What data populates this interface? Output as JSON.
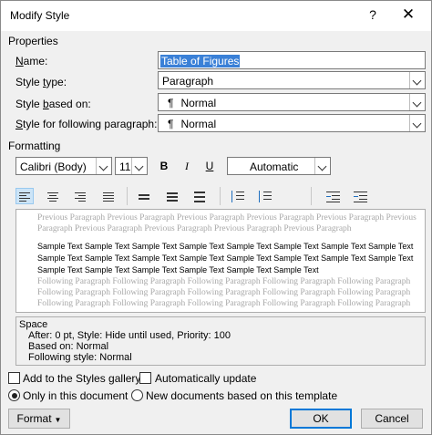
{
  "window": {
    "title": "Modify Style",
    "help": "?",
    "close": "✕"
  },
  "properties": {
    "header": "Properties",
    "name_label": "Name:",
    "name_value": "Table of Figures",
    "type_label": "Style type:",
    "type_value": "Paragraph",
    "based_label": "Style based on:",
    "based_value": "Normal",
    "following_label": "Style for following paragraph:",
    "following_value": "Normal",
    "pilcrow": "¶"
  },
  "formatting": {
    "header": "Formatting",
    "font": "Calibri (Body)",
    "size": "11",
    "bold": "B",
    "italic": "I",
    "underline": "U",
    "color": "Automatic"
  },
  "preview": {
    "previous_lines": [
      "Previous Paragraph Previous Paragraph Previous Paragraph Previous Paragraph Previous Paragraph Previous",
      "Paragraph Previous Paragraph Previous Paragraph Previous Paragraph Previous Paragraph"
    ],
    "sample_lines": [
      "Sample Text Sample Text Sample Text Sample Text Sample Text Sample Text Sample Text Sample Text",
      "Sample Text Sample Text Sample Text Sample Text Sample Text Sample Text Sample Text Sample Text",
      "Sample Text Sample Text Sample Text Sample Text Sample Text Sample Text"
    ],
    "following_lines": [
      "Following Paragraph Following Paragraph Following Paragraph Following Paragraph Following Paragraph",
      "Following Paragraph Following Paragraph Following Paragraph Following Paragraph Following Paragraph",
      "Following Paragraph Following Paragraph Following Paragraph Following Paragraph Following Paragraph"
    ]
  },
  "description": {
    "line1": "Space",
    "line2": "After:  0 pt, Style: Hide until used, Priority: 100",
    "line3": "Based on: Normal",
    "line4": "Following style: Normal"
  },
  "options": {
    "add_gallery": "Add to the Styles gallery",
    "auto_update": "Automatically update",
    "only_doc": "Only in this document",
    "new_docs": "New documents based on this template"
  },
  "buttons": {
    "format": "Format",
    "ok": "OK",
    "cancel": "Cancel"
  }
}
